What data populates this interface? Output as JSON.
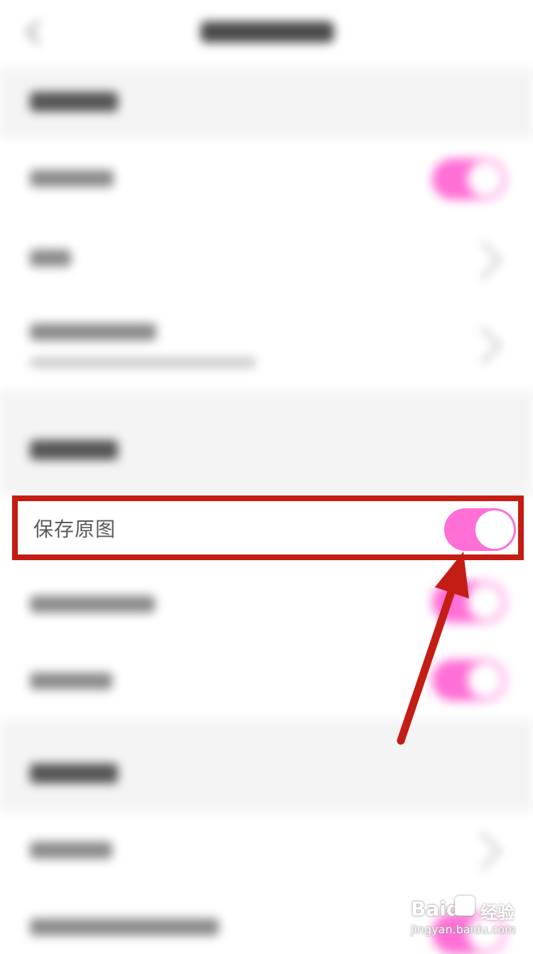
{
  "settings": {
    "save_original_label": "保存原图",
    "save_original_enabled": true
  },
  "watermark": {
    "brand": "Baidu",
    "brand_cn": "经验",
    "url": "jingyan.baidu.com"
  },
  "colors": {
    "accent": "#ff6fd6",
    "highlight": "#c41d13"
  }
}
